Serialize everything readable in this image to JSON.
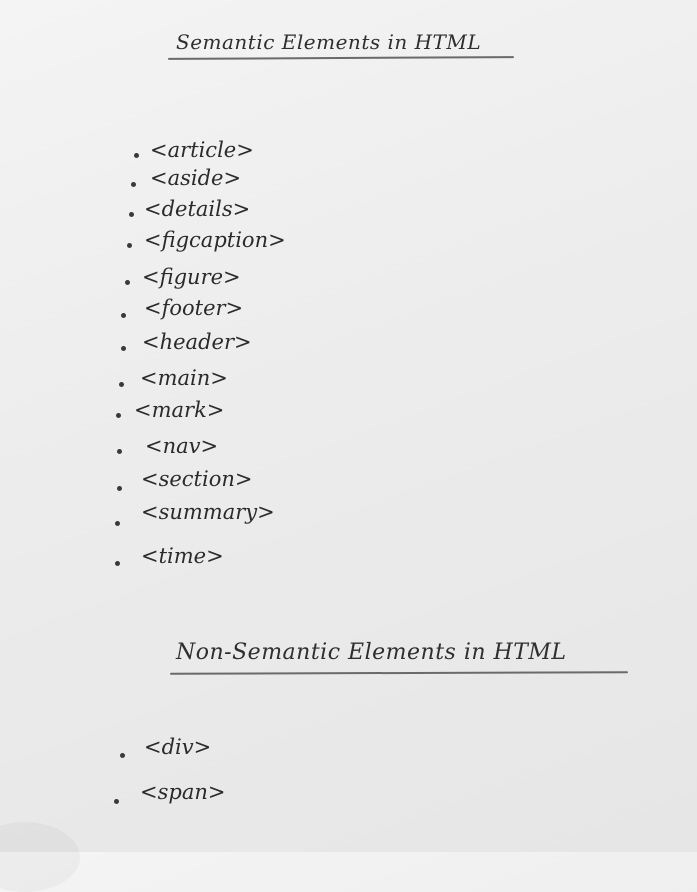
{
  "semantic": {
    "title": "Semantic Elements in HTML",
    "items": [
      "<article>",
      "<aside>",
      "<details>",
      "<figcaption>",
      "<figure>",
      "<footer>",
      "<header>",
      "<main>",
      "<mark>",
      "<nav>",
      "<section>",
      "<summary>",
      "<time>"
    ]
  },
  "non_semantic": {
    "title": "Non-Semantic Elements in HTML",
    "items": [
      "<div>",
      "<span>"
    ]
  }
}
